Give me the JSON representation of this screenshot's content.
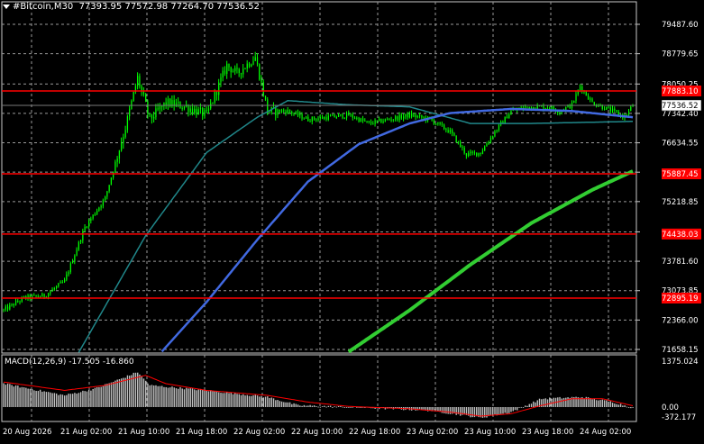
{
  "header": {
    "symbol": "#Bitcoin,M30",
    "ohlc": "77393.95 77572.98 77264.70 77536.52"
  },
  "macd": {
    "label": "MACD(12,26,9) -17.505 -16.860"
  },
  "price_axis": {
    "labels": [
      {
        "value": 79487.6,
        "text": "79487.60"
      },
      {
        "value": 78779.65,
        "text": "78779.65"
      },
      {
        "value": 78050.25,
        "text": "78050.25"
      },
      {
        "value": 77342.4,
        "text": "77342.40"
      },
      {
        "value": 76634.55,
        "text": "76634.55"
      },
      {
        "value": 75926.7,
        "text": "75926.70"
      },
      {
        "value": 75218.85,
        "text": "75218.85"
      },
      {
        "value": 74489.45,
        "text": "74489.45"
      },
      {
        "value": 73781.6,
        "text": "73781.60"
      },
      {
        "value": 73073.85,
        "text": "73073.85"
      },
      {
        "value": 72366.0,
        "text": "72366.00"
      },
      {
        "value": 71658.15,
        "text": "71658.15"
      }
    ],
    "current_price": {
      "value": 77536.52,
      "text": "77536.52"
    },
    "level_lines": [
      {
        "value": 77883.1,
        "text": "77883.10"
      },
      {
        "value": 75887.45,
        "text": "75887.45"
      },
      {
        "value": 74438.03,
        "text": "74438.03"
      },
      {
        "value": 72895.19,
        "text": "72895.19"
      }
    ]
  },
  "macd_axis": {
    "labels": [
      {
        "value": 1375.024,
        "text": "1375.024"
      },
      {
        "value": 0.0,
        "text": "0.00"
      },
      {
        "value": -372.177,
        "text": "-372.177"
      }
    ]
  },
  "time_axis": {
    "labels": [
      "20 Aug 2026",
      "21 Aug 02:00",
      "21 Aug 10:00",
      "21 Aug 18:00",
      "22 Aug 02:00",
      "22 Aug 10:00",
      "22 Aug 18:00",
      "23 Aug 02:00",
      "23 Aug 10:00",
      "23 Aug 18:00",
      "24 Aug 02:00"
    ]
  },
  "colors": {
    "background": "#000000",
    "grid": "#9a9a9a",
    "candle": "#00ff00",
    "level_line": "#ff0000",
    "ma_fast": "#20878a",
    "ma_mid": "#4169e1",
    "ma_slow": "#32cd32",
    "macd_hist": "#c0c0c0",
    "macd_signal": "#ff0000"
  },
  "chart_data": {
    "type": "candlestick",
    "x_range": [
      "20 Aug 2026",
      "24 Aug 2026"
    ],
    "ylim": [
      71600,
      79800
    ],
    "anchors": [
      [
        0,
        72600
      ],
      [
        10,
        72900
      ],
      [
        20,
        72950
      ],
      [
        30,
        73300
      ],
      [
        40,
        74600
      ],
      [
        50,
        75300
      ],
      [
        60,
        77000
      ],
      [
        66,
        78200
      ],
      [
        72,
        77200
      ],
      [
        80,
        77600
      ],
      [
        90,
        77500
      ],
      [
        100,
        77300
      ],
      [
        110,
        78500
      ],
      [
        115,
        78300
      ],
      [
        124,
        78700
      ],
      [
        130,
        77400
      ],
      [
        140,
        77400
      ],
      [
        150,
        77200
      ],
      [
        170,
        77300
      ],
      [
        180,
        77100
      ],
      [
        200,
        77300
      ],
      [
        210,
        77200
      ],
      [
        220,
        76900
      ],
      [
        228,
        76350
      ],
      [
        235,
        76400
      ],
      [
        242,
        76900
      ],
      [
        250,
        77400
      ],
      [
        258,
        77500
      ],
      [
        268,
        77500
      ],
      [
        274,
        77400
      ],
      [
        280,
        77550
      ],
      [
        284,
        78000
      ],
      [
        290,
        77600
      ],
      [
        300,
        77400
      ],
      [
        306,
        77250
      ],
      [
        310,
        77536
      ]
    ],
    "moving_averages": [
      {
        "points": [
          [
            36,
            71500
          ],
          [
            70,
            74400
          ],
          [
            100,
            76400
          ],
          [
            125,
            77250
          ],
          [
            140,
            77650
          ],
          [
            170,
            77550
          ],
          [
            200,
            77500
          ],
          [
            230,
            77100
          ],
          [
            260,
            77100
          ],
          [
            310,
            77150
          ]
        ]
      },
      {
        "points": [
          [
            76,
            71500
          ],
          [
            100,
            72800
          ],
          [
            125,
            74300
          ],
          [
            150,
            75700
          ],
          [
            175,
            76600
          ],
          [
            200,
            77100
          ],
          [
            220,
            77350
          ],
          [
            250,
            77450
          ],
          [
            280,
            77400
          ],
          [
            310,
            77250
          ]
        ]
      },
      {
        "points": [
          [
            170,
            71600
          ],
          [
            200,
            72600
          ],
          [
            230,
            73700
          ],
          [
            260,
            74700
          ],
          [
            290,
            75500
          ],
          [
            310,
            75950
          ]
        ]
      }
    ],
    "macd": {
      "ylim": [
        -500,
        1450
      ],
      "anchors": [
        [
          0,
          700
        ],
        [
          30,
          350
        ],
        [
          45,
          550
        ],
        [
          60,
          900
        ],
        [
          66,
          1050
        ],
        [
          72,
          650
        ],
        [
          100,
          500
        ],
        [
          130,
          300
        ],
        [
          145,
          50
        ],
        [
          170,
          0
        ],
        [
          210,
          -100
        ],
        [
          235,
          -320
        ],
        [
          250,
          -150
        ],
        [
          265,
          250
        ],
        [
          285,
          300
        ],
        [
          300,
          150
        ],
        [
          310,
          -20
        ]
      ],
      "signal": [
        [
          0,
          750
        ],
        [
          30,
          500
        ],
        [
          50,
          650
        ],
        [
          70,
          950
        ],
        [
          80,
          700
        ],
        [
          100,
          500
        ],
        [
          130,
          350
        ],
        [
          150,
          150
        ],
        [
          170,
          20
        ],
        [
          200,
          -50
        ],
        [
          220,
          -150
        ],
        [
          235,
          -270
        ],
        [
          250,
          -200
        ],
        [
          265,
          50
        ],
        [
          280,
          250
        ],
        [
          295,
          250
        ],
        [
          310,
          40
        ]
      ]
    }
  }
}
